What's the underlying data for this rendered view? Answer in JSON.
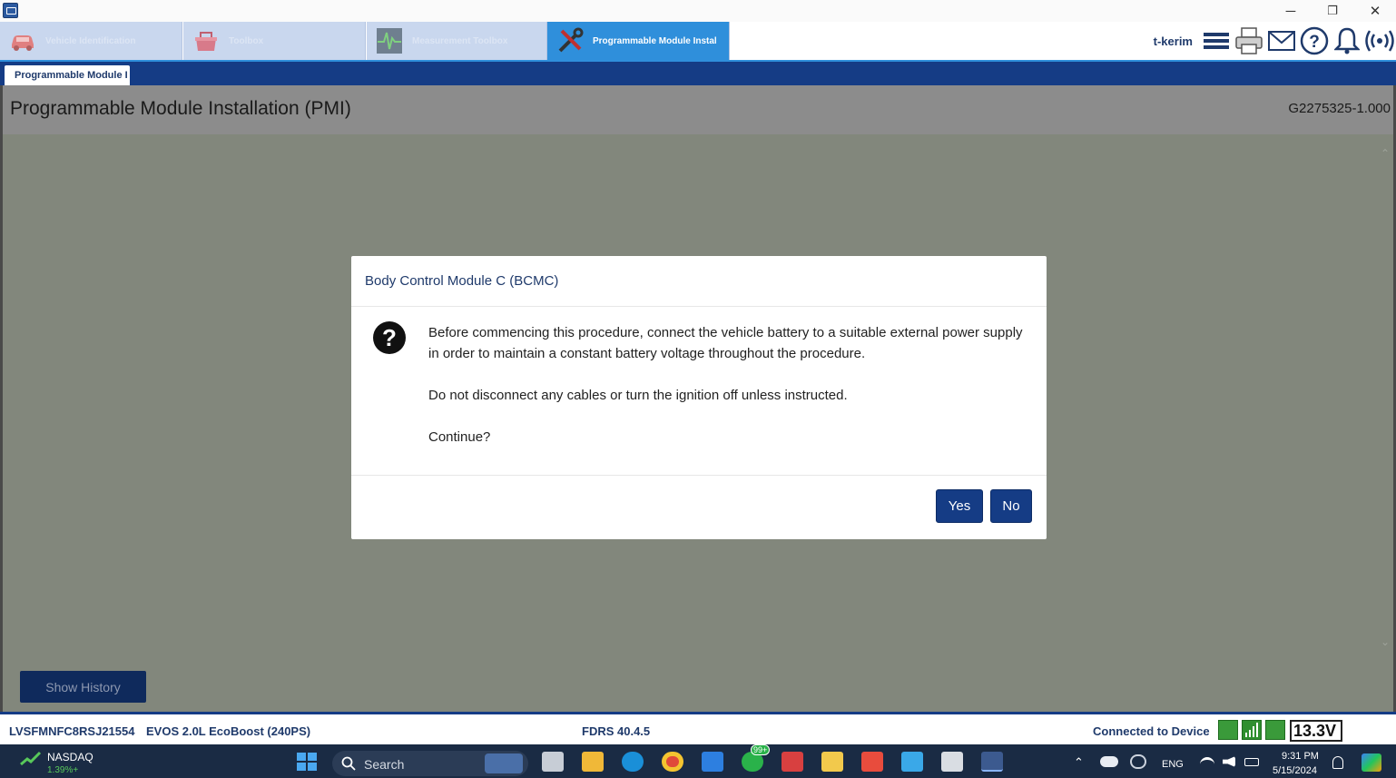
{
  "window": {
    "controls": {
      "minimize": "─",
      "restore": "❐",
      "close": "✕"
    }
  },
  "tabs": [
    {
      "label": "Vehicle Identification",
      "icon": "car-icon",
      "active": false
    },
    {
      "label": "Toolbox",
      "icon": "toolbox-icon",
      "active": false
    },
    {
      "label": "Measurement Toolbox",
      "icon": "waveform-icon",
      "active": false
    },
    {
      "label": "Programmable Module Instal",
      "icon": "wrench-screwdriver-icon",
      "active": true
    }
  ],
  "header": {
    "username": "t-kerim",
    "icons": [
      "menu-icon",
      "printer-icon",
      "mail-icon",
      "help-icon",
      "bell-icon",
      "wireless-icon"
    ]
  },
  "subtab": {
    "label": "Programmable Module I"
  },
  "page": {
    "title": "Programmable Module Installation (PMI)",
    "code": "G2275325-1.000"
  },
  "dialog": {
    "title": "Body Control Module C (BCMC)",
    "icon": "question-icon",
    "paragraphs": [
      "Before commencing this procedure, connect the vehicle battery to a suitable external power supply in order to maintain a constant battery voltage throughout the procedure.",
      "Do not disconnect any cables or turn the ignition off unless instructed.",
      "Continue?"
    ],
    "yes_label": "Yes",
    "no_label": "No"
  },
  "history_button": "Show History",
  "status": {
    "vin": "LVSFMNFC8RSJ21554",
    "engine": "EVOS 2.0L EcoBoost (240PS)",
    "version": "FDRS 40.4.5",
    "connection": "Connected to Device",
    "voltage": "13.3V"
  },
  "taskbar": {
    "stock_name": "NASDAQ",
    "stock_change": "1.39%+",
    "search_label": "Search",
    "badge": "99+",
    "lang": "ENG",
    "time": "9:31 PM",
    "date": "5/15/2024"
  },
  "colors": {
    "navy": "#153c85",
    "active_tab": "#2f8fdb",
    "overlay": "#82877c",
    "taskbar": "#1a2b44"
  }
}
